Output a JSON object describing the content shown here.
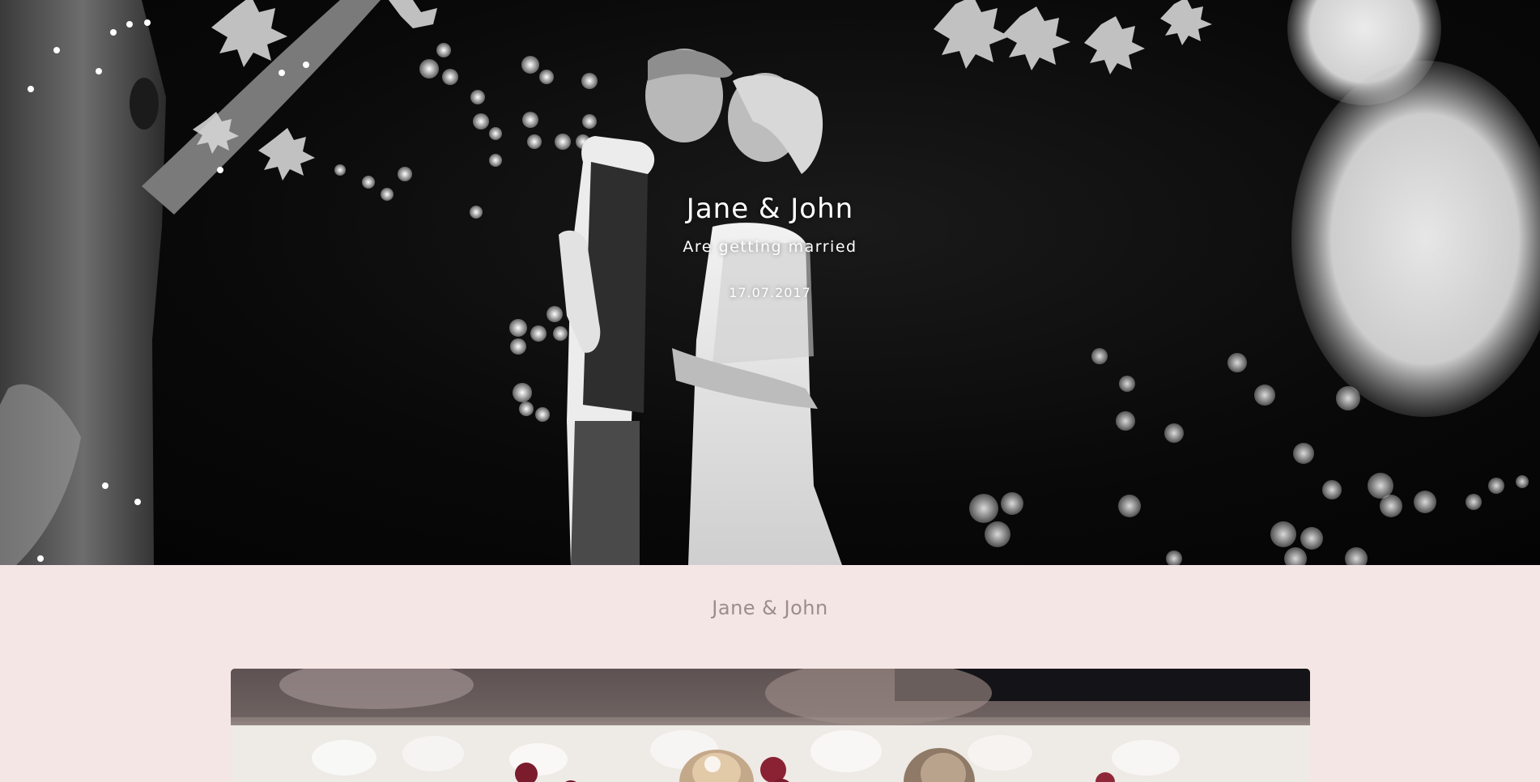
{
  "hero": {
    "title": "Jane & John",
    "subtitle": "Are getting married",
    "date": "17.07.2017"
  },
  "section": {
    "title": "Jane & John"
  },
  "colors": {
    "background": "#f5e6e6",
    "section_title": "#9b8d8d",
    "hero_text": "#ffffff"
  }
}
